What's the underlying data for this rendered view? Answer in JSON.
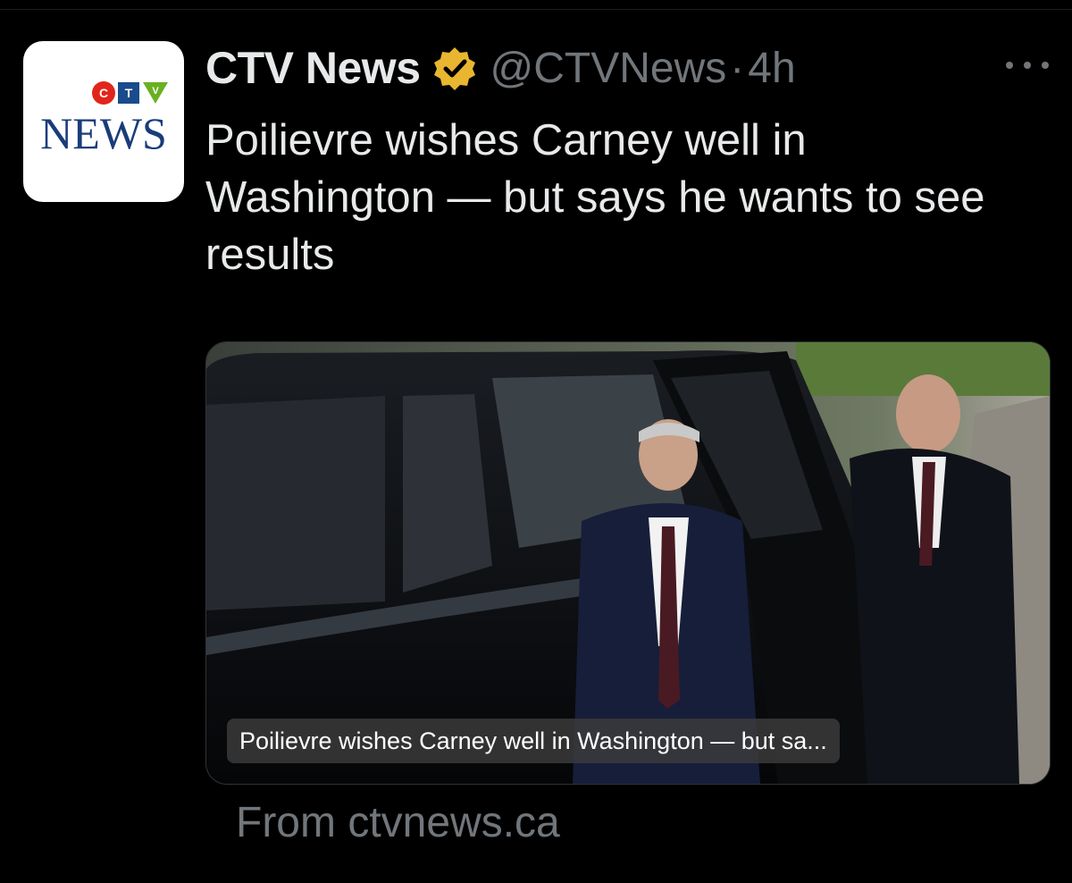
{
  "tweet": {
    "author_name": "CTV News",
    "handle": "@CTVNews",
    "separator": "·",
    "time": "4h",
    "text": "Poilievre wishes Carney well in Washington — but says he wants to see results",
    "avatar": {
      "logo_top": "CTV",
      "logo_bottom": "NEWS"
    },
    "verified_icon": "verified-badge-icon",
    "more_icon": "more-options-icon"
  },
  "card": {
    "caption": "Poilievre wishes Carney well in Washington — but sa...",
    "source": "From ctvnews.ca"
  },
  "colors": {
    "background": "#000000",
    "primary_text": "#e7e9ea",
    "secondary_text": "#71767b",
    "badge_gold": "#e8b630",
    "ctv_red": "#e1251b",
    "ctv_blue": "#1a4b8c",
    "ctv_green": "#6ab023"
  }
}
